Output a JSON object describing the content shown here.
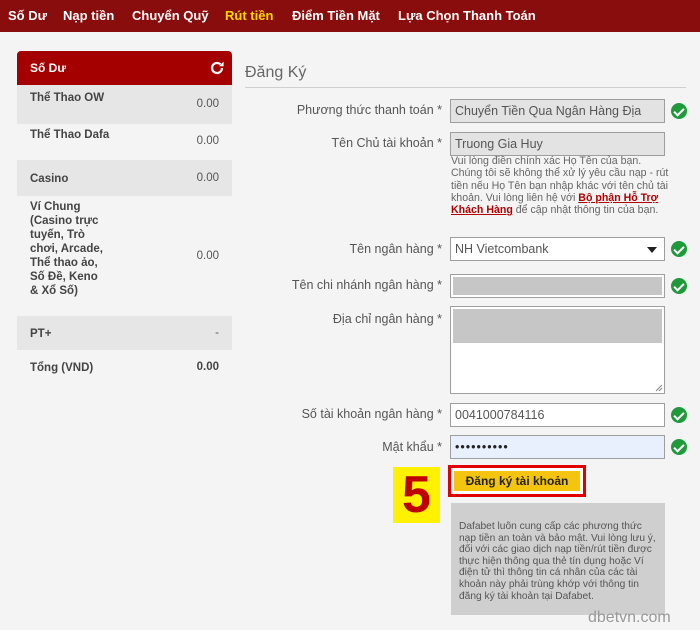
{
  "nav": {
    "items": [
      "Số Dư",
      "Nạp tiền",
      "Chuyển Quỹ",
      "Rút tiền",
      "Điểm Tiền Mặt",
      "Lựa Chọn Thanh Toán"
    ],
    "active_index": 3
  },
  "sidebar": {
    "title": "Số Dư",
    "rows": [
      {
        "name": "Thể Thao OW",
        "value": "0.00"
      },
      {
        "name": "Thể Thao Dafa",
        "value": "0.00"
      },
      {
        "name": "Casino",
        "value": "0.00"
      },
      {
        "name": "Ví Chung (Casino trực tuyến, Trò chơi, Arcade, Thể thao ảo, Số Đề, Keno & Xổ Số)",
        "value": "0.00"
      },
      {
        "name": "PT+",
        "value": "-"
      }
    ],
    "total": {
      "name": "Tổng (VND)",
      "value": "0.00"
    }
  },
  "form": {
    "title": "Đăng Ký",
    "fields": {
      "payment_method": {
        "label": "Phương thức thanh toán *",
        "value": "Chuyển Tiền Qua Ngân Hàng Địa"
      },
      "account_holder": {
        "label": "Tên Chủ tài khoản *",
        "value": "Truong Gia Huy"
      },
      "bank_name": {
        "label": "Tên ngân hàng *",
        "value": "NH Vietcombank"
      },
      "branch_name": {
        "label": "Tên chi nhánh ngân hàng *",
        "value": ""
      },
      "bank_address": {
        "label": "Địa chỉ ngân hàng *",
        "value": ""
      },
      "account_number": {
        "label": "Số tài khoản ngân hàng *",
        "value": "0041000784116"
      },
      "password": {
        "label": "Mật khẩu *",
        "value": "••••••••••"
      }
    },
    "holder_help": {
      "before": "Vui lòng điền chính xác Họ Tên của bạn. Chúng tôi sẽ không thể xử lý yêu cầu nạp - rút tiền nếu Họ Tên bạn nhập khác với tên chủ tài khoản. Vui lòng liên hệ với ",
      "link": "Bộ phận Hỗ Trợ Khách Hàng",
      "after": " để cập nhật thông tin của bạn."
    },
    "step_badge": "5",
    "submit_label": "Đăng ký tài khoản",
    "notice": "Dafabet luôn cung cấp các phương thức nạp tiền an toàn và bảo mật. Vui lòng lưu ý, đối với các giao dịch nạp tiền/rút tiền được thực hiện thông qua thẻ tín dụng hoặc Ví điện tử thì thông tin cá nhân của các tài khoản này phải trùng khớp với thông tin đăng ký tài khoản tại Dafabet."
  },
  "watermark": "dbetvn.com",
  "colors": {
    "nav_bg": "#8a0d0d",
    "active": "#f6d600",
    "sidebar_head": "#a40000",
    "check": "#1e9a3a",
    "badge": "#fff200",
    "badge_text": "#c00000"
  }
}
